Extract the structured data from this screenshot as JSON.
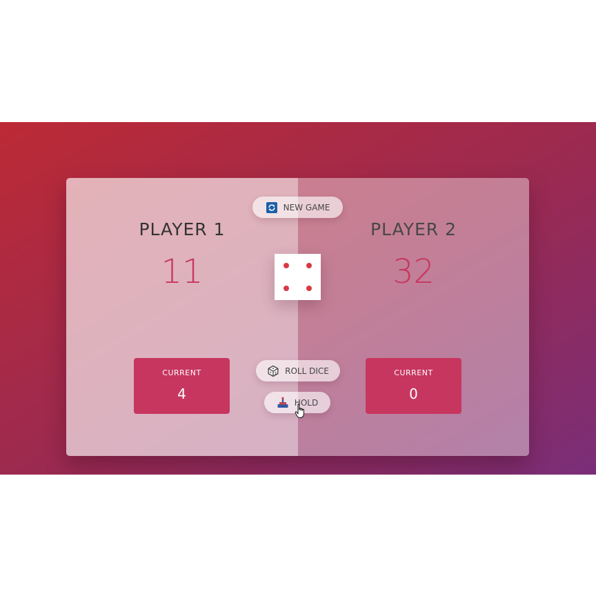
{
  "players": [
    {
      "name": "PLAYER 1",
      "score": "11",
      "current_label": "CURRENT",
      "current_score": "4"
    },
    {
      "name": "PLAYER 2",
      "score": "32",
      "current_label": "CURRENT",
      "current_score": "0"
    }
  ],
  "buttons": {
    "new_game": "NEW GAME",
    "roll_dice": "ROLL DICE",
    "hold": "HOLD"
  },
  "dice": {
    "value": 4
  },
  "icons": {
    "new_game": "refresh-icon",
    "roll_dice": "dice-icon",
    "hold": "hold-icon"
  },
  "colors": {
    "accent": "#c7365f",
    "dice_pip": "#d93a45",
    "gradient_start": "#bc2a35",
    "gradient_end": "#7a2e78"
  }
}
